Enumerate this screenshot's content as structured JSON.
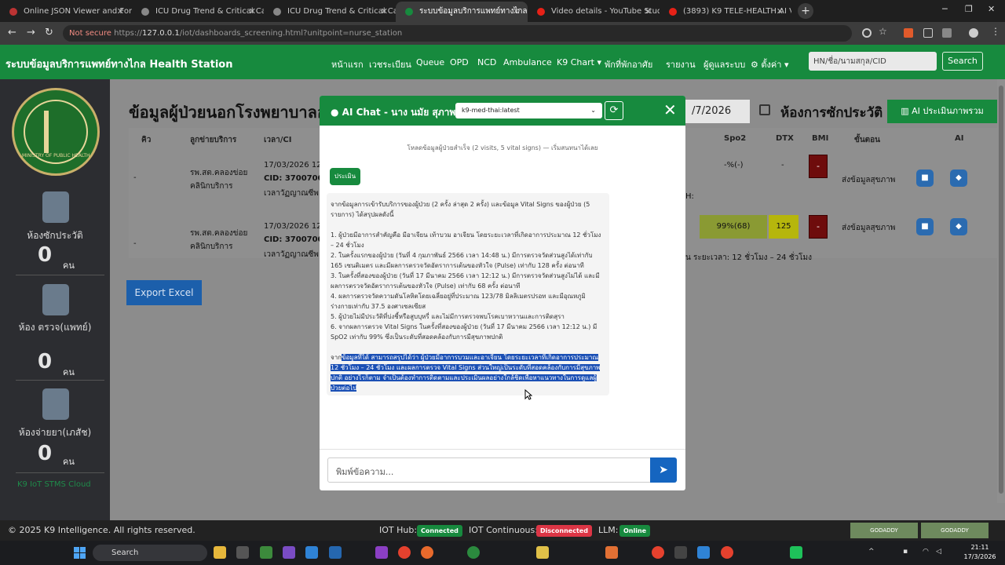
{
  "browser": {
    "tabs": [
      {
        "label": "Online JSON Viewer and Forma",
        "active": false,
        "color": "#c73737"
      },
      {
        "label": "ICU Drug Trend & Critical Care",
        "active": false,
        "color": "#666666"
      },
      {
        "label": "ICU Drug Trend & Critical Care",
        "active": false,
        "color": "#666666"
      },
      {
        "label": "ระบบข้อมูลบริการแพทย์ทางไกล Health Station",
        "active": true,
        "color": "#178a3e"
      },
      {
        "label": "Video details - YouTube Studio",
        "active": false,
        "color": "#e62117"
      },
      {
        "label": "(3893) K9 TELE-HEALTH AI Ve",
        "active": false,
        "color": "#e62117"
      }
    ],
    "url_security": "Not secure",
    "url_protocol": "https://",
    "url_host": "127.0.0.1",
    "url_path": "/iot/dashboards_screening.html?unitpoint=nurse_station"
  },
  "navbar": {
    "brand": "ระบบข้อมูลบริการแพทย์ทางไกล Health Station",
    "menu": [
      "หน้าแรก",
      "เวชระเบียน",
      "Queue",
      "OPD",
      "NCD",
      "Ambulance",
      "K9 Chart",
      "พักที่พักอาศัย",
      "รายงาน",
      "ผู้ดูแลระบบ",
      "ตั้งค่า"
    ],
    "search_placeholder": "HN/ชื่อ/นามสกุล/CID",
    "search_button": "Search"
  },
  "sidebar": {
    "logo_text": "MINISTRY OF PUBLIC HEALTH",
    "stations": [
      {
        "label": "ห้องซักประวัติ",
        "count": "0",
        "unit": "คน"
      },
      {
        "label": "ห้อง ตรวจ(แพทย์)",
        "count": "0",
        "unit": "คน"
      },
      {
        "label": "ห้องจ่ายยา(เภสัช)",
        "count": "0",
        "unit": "คน"
      }
    ],
    "footer": "K9 IoT STMS Cloud"
  },
  "page": {
    "title": "ข้อมูลผู้ป่วยนอกโรงพยาบาลอ",
    "title_right": "ห้องการซักประวัติ",
    "date": "/7/2026",
    "ai_button": "AI ประเมินภาพรวม",
    "export_button": "Export Excel",
    "table_headers": [
      "คิว",
      "ลูกข่ายบริการ",
      "เวลา/CI",
      "Spo2",
      "DTX",
      "BMI",
      "ขั้นตอน",
      "AI"
    ],
    "rows": [
      {
        "queue": "-",
        "unit_l1": "รพ.สต.คลองข่อย",
        "unit_l2": "คลินิกบริการ",
        "datetime": "17/03/2026 12",
        "cid_label": "CID:",
        "cid": "3700700",
        "name": "เวลาวัฏญาณซีพ",
        "spo2": "-%(-)",
        "dtx": "-",
        "bmi": "-",
        "status": "ส่งข้อมูลสุขภาพ",
        "note": ""
      },
      {
        "queue": "-",
        "unit_l1": "รพ.สต.คลองข่อย",
        "unit_l2": "คลินิกบริการ",
        "datetime": "17/03/2026 12",
        "cid_label": "CID:",
        "cid": "3700700",
        "name": "เวลาวัฏญาณซีพ",
        "spo2": "99%(68)",
        "dtx": "125",
        "bmi": "-",
        "status": "ส่งข้อมูลสุขภาพ",
        "note": "น ระยะเวลา: 12 ชั่วโมง – 24 ชั่วโมง"
      }
    ],
    "row1_extra": "H:"
  },
  "chat": {
    "title": "AI Chat - นาง นมัย สุภาพ",
    "model": "k9-med-thai:latest",
    "system_message": "โหลดข้อมูลผู้ป่วยสำเร็จ (2 visits, 5 vital signs) — เริ่มสนทนาได้เลย",
    "user_message": "ประเมิน",
    "bot_intro": "จากข้อมูลการเข้ารับบริการของผู้ป่วย (2 ครั้ง ล่าสุด 2 ครั้ง) และข้อมูล Vital Signs ของผู้ป่วย (5 รายการ) ได้สรุปผลดังนี้",
    "bot_points": [
      "1. ผู้ป่วยมีอาการสำคัญคือ มีอาเจียน เท้าบวม อาเจียน โดยระยะเวลาที่เกิดอาการประมาณ 12 ชั่วโมง – 24 ชั่วโมง",
      "2. ในครั้งแรกของผู้ป่วย (วันที่ 4 กุมภาพันธ์ 2566 เวลา 14:48 น.) มีการตรวจวัดส่วนสูงได้เท่ากับ 165 เซนติเมตร และมีผลการตรวจวัดอัตราการเต้นของหัวใจ (Pulse) เท่ากับ 128 ครั้ง ต่อนาที",
      "3. ในครั้งที่สองของผู้ป่วย (วันที่ 17 มีนาคม 2566 เวลา 12:12 น.) มีการตรวจวัดส่วนสูงไม่ได้ และมีผลการตรวจวัดอัตราการเต้นของหัวใจ (Pulse) เท่ากับ 68 ครั้ง ต่อนาที",
      "4. ผลการตรวจวัดความดันโลหิตโดยเฉลี่ยอยู่ที่ประมาณ 123/78 มิลลิเมตรปรอท และมีอุณหภูมิร่างกายเท่ากับ 37.5 องศาเซลเซียส",
      "5. ผู้ป่วยไม่มีประวัติที่บ่งชี้หรือสูบบุหรี่ และไม่มีการตรวจพบโรคเบาหวานและการติดสุรา",
      "6. จากผลการตรวจ Vital Signs ในครั้งที่สองของผู้ป่วย (วันที่ 17 มีนาคม 2566 เวลา 12:12 น.) มี SpO2 เท่ากับ 99% ซึ่งเป็นระดับที่สอดคล้องกับการมีสุขภาพปกติ"
    ],
    "bot_conclusion_plain": "จาก",
    "bot_conclusion_hl": "ข้อมูลที่ได้ สามารถสรุปได้ว่า ผู้ป่วยมีอาการบวมและอาเจียน โดยระยะเวลาที่เกิดอาการประมาณ 12 ชั่วโมง – 24 ชั่วโมง และผลการตรวจ Vital Signs ส่วนใหญ่เป็นระดับที่สอดคล้องกับการมีสุขภาพปกติ อย่างไรก็ตาม จำเป็นต้องทำการติดตามและประเมินผลอย่างใกล้ชิดเพื่อหาแนวทางในการดูแลผู้ป่วยต่อไป",
    "input_placeholder": "พิมพ์ข้อความ..."
  },
  "footer": {
    "copyright": "© 2025 K9 Intelligence. All rights reserved.",
    "iot_hub_label": "IOT Hub:",
    "iot_hub_status": "Connected",
    "iot_cont_label": "IOT Continuous:",
    "iot_cont_status": "Disconnected",
    "llm_label": "LLM:",
    "llm_status": "Online",
    "seal": "GODADDY"
  },
  "taskbar": {
    "search": "Search",
    "time": "21:11",
    "date": "17/3/2026"
  },
  "colors": {
    "brand_green": "#178a3e",
    "danger": "#dc3545",
    "primary": "#1565c0"
  }
}
